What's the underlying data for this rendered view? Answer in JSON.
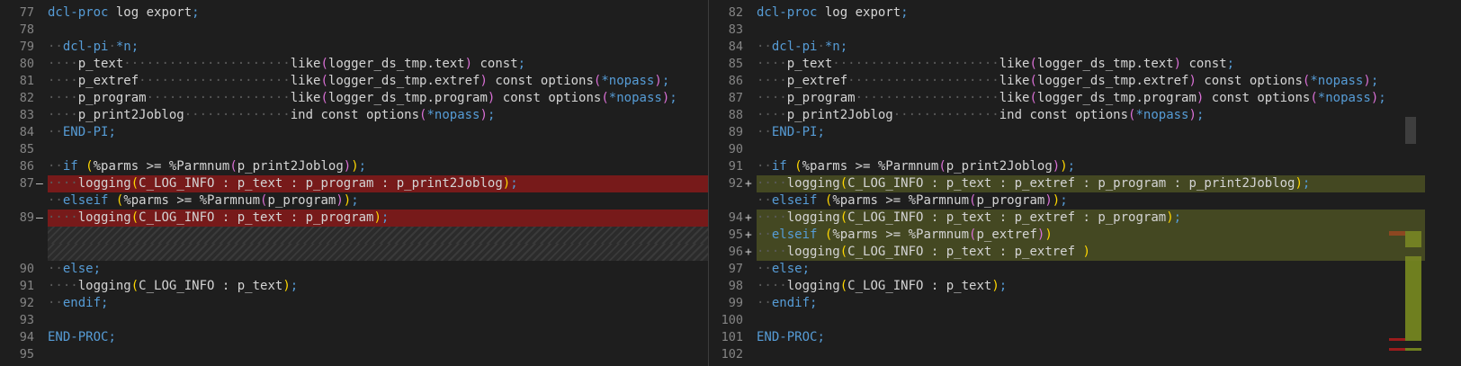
{
  "left": {
    "rows": [
      {
        "num": "77",
        "type": "ctx",
        "tokens": [
          [
            "kw",
            "dcl-proc"
          ],
          [
            "txt",
            " log export"
          ],
          [
            "sym",
            ";"
          ]
        ]
      },
      {
        "num": "78",
        "type": "ctx",
        "tokens": []
      },
      {
        "num": "79",
        "type": "ctx",
        "tokens": [
          [
            "ws",
            "··"
          ],
          [
            "kw",
            "dcl-pi"
          ],
          [
            "ws",
            "·"
          ],
          [
            "kw",
            "*n"
          ],
          [
            "sym",
            ";"
          ]
        ]
      },
      {
        "num": "80",
        "type": "ctx",
        "tokens": [
          [
            "ws",
            "····"
          ],
          [
            "txt",
            "p_text"
          ],
          [
            "ws",
            "······················"
          ],
          [
            "txt",
            "like"
          ],
          [
            "p2",
            "("
          ],
          [
            "txt",
            "logger_ds_tmp.text"
          ],
          [
            "p2",
            ")"
          ],
          [
            "txt",
            " const"
          ],
          [
            "sym",
            ";"
          ]
        ]
      },
      {
        "num": "81",
        "type": "ctx",
        "tokens": [
          [
            "ws",
            "····"
          ],
          [
            "txt",
            "p_extref"
          ],
          [
            "ws",
            "····················"
          ],
          [
            "txt",
            "like"
          ],
          [
            "p2",
            "("
          ],
          [
            "txt",
            "logger_ds_tmp.extref"
          ],
          [
            "p2",
            ")"
          ],
          [
            "txt",
            " const options"
          ],
          [
            "p2",
            "("
          ],
          [
            "kw",
            "*nopass"
          ],
          [
            "p2",
            ")"
          ],
          [
            "sym",
            ";"
          ]
        ]
      },
      {
        "num": "82",
        "type": "ctx",
        "tokens": [
          [
            "ws",
            "····"
          ],
          [
            "txt",
            "p_program"
          ],
          [
            "ws",
            "···················"
          ],
          [
            "txt",
            "like"
          ],
          [
            "p2",
            "("
          ],
          [
            "txt",
            "logger_ds_tmp.program"
          ],
          [
            "p2",
            ")"
          ],
          [
            "txt",
            " const options"
          ],
          [
            "p2",
            "("
          ],
          [
            "kw",
            "*nopass"
          ],
          [
            "p2",
            ")"
          ],
          [
            "sym",
            ";"
          ]
        ]
      },
      {
        "num": "83",
        "type": "ctx",
        "tokens": [
          [
            "ws",
            "····"
          ],
          [
            "txt",
            "p_print2Joblog"
          ],
          [
            "ws",
            "··············"
          ],
          [
            "txt",
            "ind const options"
          ],
          [
            "p2",
            "("
          ],
          [
            "kw",
            "*nopass"
          ],
          [
            "p2",
            ")"
          ],
          [
            "sym",
            ";"
          ]
        ]
      },
      {
        "num": "84",
        "type": "ctx",
        "tokens": [
          [
            "ws",
            "··"
          ],
          [
            "kw",
            "END-PI"
          ],
          [
            "sym",
            ";"
          ]
        ]
      },
      {
        "num": "85",
        "type": "ctx",
        "tokens": []
      },
      {
        "num": "86",
        "type": "ctx",
        "tokens": [
          [
            "ws",
            "··"
          ],
          [
            "kw",
            "if"
          ],
          [
            "txt",
            " "
          ],
          [
            "p1",
            "("
          ],
          [
            "txt",
            "%parms >= %Parmnum"
          ],
          [
            "p2",
            "("
          ],
          [
            "txt",
            "p_print2Joblog"
          ],
          [
            "p2",
            ")"
          ],
          [
            "p1",
            ")"
          ],
          [
            "sym",
            ";"
          ]
        ]
      },
      {
        "num": "87",
        "mark": "—",
        "type": "del",
        "tokens": [
          [
            "ws",
            "····"
          ],
          [
            "txt",
            "logging"
          ],
          [
            "p1",
            "("
          ],
          [
            "txt",
            "C_LOG_INFO : p_text : p_program : p_print2Joblog"
          ],
          [
            "p1",
            ")"
          ],
          [
            "sym",
            ";"
          ]
        ]
      },
      {
        "num": "",
        "type": "ctx",
        "tokens": [
          [
            "ws",
            "··"
          ],
          [
            "kw",
            "elseif"
          ],
          [
            "txt",
            " "
          ],
          [
            "p1",
            "("
          ],
          [
            "txt",
            "%parms >= %Parmnum"
          ],
          [
            "p2",
            "("
          ],
          [
            "txt",
            "p_program"
          ],
          [
            "p2",
            ")"
          ],
          [
            "p1",
            ")"
          ],
          [
            "sym",
            ";"
          ]
        ]
      },
      {
        "num": "89",
        "mark": "—",
        "type": "del",
        "tokens": [
          [
            "ws",
            "····"
          ],
          [
            "txt",
            "logging"
          ],
          [
            "p1",
            "("
          ],
          [
            "txt",
            "C_LOG_INFO : p_text : p_program"
          ],
          [
            "p1",
            ")"
          ],
          [
            "sym",
            ";"
          ]
        ]
      },
      {
        "num": "",
        "type": "filler"
      },
      {
        "num": "",
        "type": "filler"
      },
      {
        "num": "90",
        "type": "ctx",
        "tokens": [
          [
            "ws",
            "··"
          ],
          [
            "kw",
            "else"
          ],
          [
            "sym",
            ";"
          ]
        ]
      },
      {
        "num": "91",
        "type": "ctx",
        "tokens": [
          [
            "ws",
            "····"
          ],
          [
            "txt",
            "logging"
          ],
          [
            "p1",
            "("
          ],
          [
            "txt",
            "C_LOG_INFO : p_text"
          ],
          [
            "p1",
            ")"
          ],
          [
            "sym",
            ";"
          ]
        ]
      },
      {
        "num": "92",
        "type": "ctx",
        "tokens": [
          [
            "ws",
            "··"
          ],
          [
            "kw",
            "endif"
          ],
          [
            "sym",
            ";"
          ]
        ]
      },
      {
        "num": "93",
        "type": "ctx",
        "tokens": []
      },
      {
        "num": "94",
        "type": "ctx",
        "tokens": [
          [
            "kw",
            "END-PROC"
          ],
          [
            "sym",
            ";"
          ]
        ]
      },
      {
        "num": "95",
        "type": "ctx",
        "tokens": []
      }
    ]
  },
  "right": {
    "rows": [
      {
        "num": "82",
        "type": "ctx",
        "tokens": [
          [
            "kw",
            "dcl-proc"
          ],
          [
            "txt",
            " log export"
          ],
          [
            "sym",
            ";"
          ]
        ]
      },
      {
        "num": "83",
        "type": "ctx",
        "tokens": []
      },
      {
        "num": "84",
        "type": "ctx",
        "tokens": [
          [
            "ws",
            "··"
          ],
          [
            "kw",
            "dcl-pi"
          ],
          [
            "ws",
            "·"
          ],
          [
            "kw",
            "*n"
          ],
          [
            "sym",
            ";"
          ]
        ]
      },
      {
        "num": "85",
        "type": "ctx",
        "tokens": [
          [
            "ws",
            "····"
          ],
          [
            "txt",
            "p_text"
          ],
          [
            "ws",
            "······················"
          ],
          [
            "txt",
            "like"
          ],
          [
            "p2",
            "("
          ],
          [
            "txt",
            "logger_ds_tmp.text"
          ],
          [
            "p2",
            ")"
          ],
          [
            "txt",
            " const"
          ],
          [
            "sym",
            ";"
          ]
        ]
      },
      {
        "num": "86",
        "type": "ctx",
        "tokens": [
          [
            "ws",
            "····"
          ],
          [
            "txt",
            "p_extref"
          ],
          [
            "ws",
            "····················"
          ],
          [
            "txt",
            "like"
          ],
          [
            "p2",
            "("
          ],
          [
            "txt",
            "logger_ds_tmp.extref"
          ],
          [
            "p2",
            ")"
          ],
          [
            "txt",
            " const options"
          ],
          [
            "p2",
            "("
          ],
          [
            "kw",
            "*nopass"
          ],
          [
            "p2",
            ")"
          ],
          [
            "sym",
            ";"
          ]
        ]
      },
      {
        "num": "87",
        "type": "ctx",
        "tokens": [
          [
            "ws",
            "····"
          ],
          [
            "txt",
            "p_program"
          ],
          [
            "ws",
            "···················"
          ],
          [
            "txt",
            "like"
          ],
          [
            "p2",
            "("
          ],
          [
            "txt",
            "logger_ds_tmp.program"
          ],
          [
            "p2",
            ")"
          ],
          [
            "txt",
            " const options"
          ],
          [
            "p2",
            "("
          ],
          [
            "kw",
            "*nopass"
          ],
          [
            "p2",
            ")"
          ],
          [
            "sym",
            ";"
          ]
        ]
      },
      {
        "num": "88",
        "type": "ctx",
        "tokens": [
          [
            "ws",
            "····"
          ],
          [
            "txt",
            "p_print2Joblog"
          ],
          [
            "ws",
            "··············"
          ],
          [
            "txt",
            "ind const options"
          ],
          [
            "p2",
            "("
          ],
          [
            "kw",
            "*nopass"
          ],
          [
            "p2",
            ")"
          ],
          [
            "sym",
            ";"
          ]
        ]
      },
      {
        "num": "89",
        "type": "ctx",
        "tokens": [
          [
            "ws",
            "··"
          ],
          [
            "kw",
            "END-PI"
          ],
          [
            "sym",
            ";"
          ]
        ]
      },
      {
        "num": "90",
        "type": "ctx",
        "tokens": []
      },
      {
        "num": "91",
        "type": "ctx",
        "tokens": [
          [
            "ws",
            "··"
          ],
          [
            "kw",
            "if"
          ],
          [
            "txt",
            " "
          ],
          [
            "p1",
            "("
          ],
          [
            "txt",
            "%parms >= %Parmnum"
          ],
          [
            "p2",
            "("
          ],
          [
            "txt",
            "p_print2Joblog"
          ],
          [
            "p2",
            ")"
          ],
          [
            "p1",
            ")"
          ],
          [
            "sym",
            ";"
          ]
        ]
      },
      {
        "num": "92",
        "mark": "+",
        "type": "ins",
        "tokens": [
          [
            "ws",
            "····"
          ],
          [
            "txt",
            "logging"
          ],
          [
            "p1",
            "("
          ],
          [
            "txt",
            "C_LOG_INFO : p_text : p_extref : p_program : p_print2Joblog"
          ],
          [
            "p1",
            ")"
          ],
          [
            "sym",
            ";"
          ]
        ]
      },
      {
        "num": "",
        "type": "ctx",
        "tokens": [
          [
            "ws",
            "··"
          ],
          [
            "kw",
            "elseif"
          ],
          [
            "txt",
            " "
          ],
          [
            "p1",
            "("
          ],
          [
            "txt",
            "%parms >= %Parmnum"
          ],
          [
            "p2",
            "("
          ],
          [
            "txt",
            "p_program"
          ],
          [
            "p2",
            ")"
          ],
          [
            "p1",
            ")"
          ],
          [
            "sym",
            ";"
          ]
        ]
      },
      {
        "num": "94",
        "mark": "+",
        "type": "ins",
        "tokens": [
          [
            "ws",
            "····"
          ],
          [
            "txt",
            "logging"
          ],
          [
            "p1",
            "("
          ],
          [
            "txt",
            "C_LOG_INFO : p_text : p_extref : p_program"
          ],
          [
            "p1",
            ")"
          ],
          [
            "sym",
            ";"
          ]
        ]
      },
      {
        "num": "95",
        "mark": "+",
        "type": "ins",
        "tokens": [
          [
            "ws",
            "··"
          ],
          [
            "kw",
            "elseif"
          ],
          [
            "txt",
            " "
          ],
          [
            "p1",
            "("
          ],
          [
            "txt",
            "%parms >= %Parmnum"
          ],
          [
            "p2",
            "("
          ],
          [
            "txt",
            "p_extref"
          ],
          [
            "p2",
            ")"
          ],
          [
            "p1",
            ")"
          ]
        ]
      },
      {
        "num": "96",
        "mark": "+",
        "type": "ins",
        "tokens": [
          [
            "ws",
            "····"
          ],
          [
            "txt",
            "logging"
          ],
          [
            "p1",
            "("
          ],
          [
            "txt",
            "C_LOG_INFO : p_text : p_extref "
          ],
          [
            "p1",
            ")"
          ]
        ]
      },
      {
        "num": "97",
        "type": "ctx",
        "tokens": [
          [
            "ws",
            "··"
          ],
          [
            "kw",
            "else"
          ],
          [
            "sym",
            ";"
          ]
        ]
      },
      {
        "num": "98",
        "type": "ctx",
        "tokens": [
          [
            "ws",
            "····"
          ],
          [
            "txt",
            "logging"
          ],
          [
            "p1",
            "("
          ],
          [
            "txt",
            "C_LOG_INFO : p_text"
          ],
          [
            "p1",
            ")"
          ],
          [
            "sym",
            ";"
          ]
        ]
      },
      {
        "num": "99",
        "type": "ctx",
        "tokens": [
          [
            "ws",
            "··"
          ],
          [
            "kw",
            "endif"
          ],
          [
            "sym",
            ";"
          ]
        ]
      },
      {
        "num": "100",
        "type": "ctx",
        "tokens": []
      },
      {
        "num": "101",
        "type": "ctx",
        "tokens": [
          [
            "kw",
            "END-PROC"
          ],
          [
            "sym",
            ";"
          ]
        ]
      },
      {
        "num": "102",
        "type": "ctx",
        "tokens": []
      }
    ]
  },
  "colors": {
    "deleted": "#7a1f1f",
    "inserted": "#5b6420",
    "keyword": "#569cd6",
    "bracket1": "#ffd700",
    "bracket2": "#da70d6"
  }
}
